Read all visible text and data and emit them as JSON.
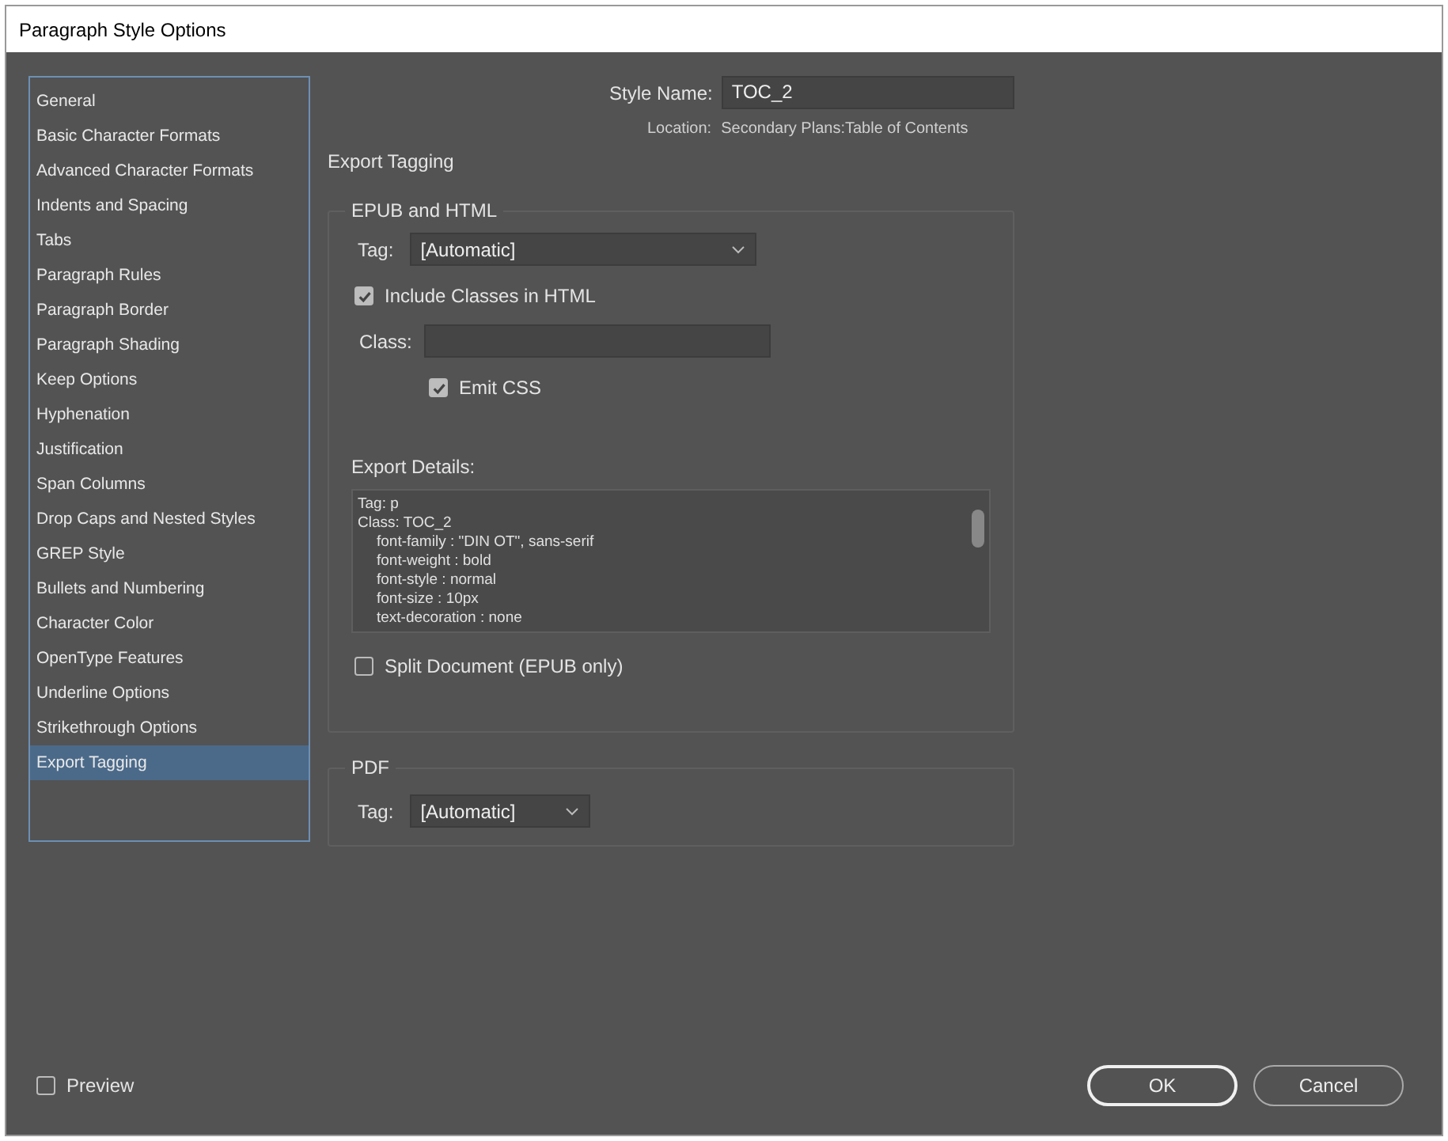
{
  "window": {
    "title": "Paragraph Style Options"
  },
  "sidebar": {
    "items": [
      {
        "label": "General",
        "selected": false
      },
      {
        "label": "Basic Character Formats",
        "selected": false
      },
      {
        "label": "Advanced Character Formats",
        "selected": false
      },
      {
        "label": "Indents and Spacing",
        "selected": false
      },
      {
        "label": "Tabs",
        "selected": false
      },
      {
        "label": "Paragraph Rules",
        "selected": false
      },
      {
        "label": "Paragraph Border",
        "selected": false
      },
      {
        "label": "Paragraph Shading",
        "selected": false
      },
      {
        "label": "Keep Options",
        "selected": false
      },
      {
        "label": "Hyphenation",
        "selected": false
      },
      {
        "label": "Justification",
        "selected": false
      },
      {
        "label": "Span Columns",
        "selected": false
      },
      {
        "label": "Drop Caps and Nested Styles",
        "selected": false
      },
      {
        "label": "GREP Style",
        "selected": false
      },
      {
        "label": "Bullets and Numbering",
        "selected": false
      },
      {
        "label": "Character Color",
        "selected": false
      },
      {
        "label": "OpenType Features",
        "selected": false
      },
      {
        "label": "Underline Options",
        "selected": false
      },
      {
        "label": "Strikethrough Options",
        "selected": false
      },
      {
        "label": "Export Tagging",
        "selected": true
      }
    ]
  },
  "style_name": {
    "label": "Style Name:",
    "value": "TOC_2"
  },
  "location": {
    "label": "Location:",
    "value": "Secondary Plans:Table of Contents"
  },
  "section_title": "Export Tagging",
  "epub": {
    "legend": "EPUB and HTML",
    "tag_label": "Tag:",
    "tag_value": "[Automatic]",
    "include_classes": {
      "label": "Include Classes in HTML",
      "checked": true
    },
    "class_label": "Class:",
    "emit_css": {
      "label": "Emit CSS",
      "checked": true
    },
    "details_label": "Export Details:",
    "details_lines": [
      {
        "text": "Tag: p",
        "indented": false
      },
      {
        "text": "Class: TOC_2",
        "indented": false
      },
      {
        "text": "font-family : \"DIN OT\", sans-serif",
        "indented": true
      },
      {
        "text": "font-weight : bold",
        "indented": true
      },
      {
        "text": "font-style : normal",
        "indented": true
      },
      {
        "text": "font-size : 10px",
        "indented": true
      },
      {
        "text": "text-decoration : none",
        "indented": true
      }
    ],
    "split_document": {
      "label": "Split Document (EPUB only)",
      "checked": false
    }
  },
  "pdf": {
    "legend": "PDF",
    "tag_label": "Tag:",
    "tag_value": "[Automatic]"
  },
  "preview": {
    "label": "Preview",
    "checked": false
  },
  "buttons": [
    {
      "label": "OK",
      "kind": "primary"
    },
    {
      "label": "Cancel",
      "kind": "secondary"
    }
  ]
}
